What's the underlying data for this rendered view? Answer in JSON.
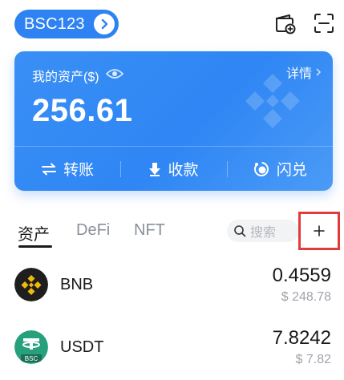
{
  "header": {
    "wallet_name": "BSC123",
    "wallet_switch_icon": "chevron-right-icon",
    "add_wallet_icon": "wallet-add-icon",
    "scan_icon": "scan-icon"
  },
  "asset_card": {
    "title": "我的资产($)",
    "visibility_icon": "eye-icon",
    "details_label": "详情",
    "total": "256.61",
    "watermark_icon": "bnb-icon",
    "actions": [
      {
        "label": "转账",
        "icon": "transfer-icon"
      },
      {
        "label": "收款",
        "icon": "receive-icon"
      },
      {
        "label": "闪兑",
        "icon": "swap-icon"
      }
    ]
  },
  "tabs": [
    {
      "label": "资产",
      "active": true
    },
    {
      "label": "DeFi",
      "active": false
    },
    {
      "label": "NFT",
      "active": false
    }
  ],
  "search": {
    "placeholder": "搜索",
    "icon": "search-icon"
  },
  "add_token_icon": "plus-icon",
  "tokens": [
    {
      "symbol": "BNB",
      "balance": "0.4559",
      "usd": "$ 248.78",
      "logo_color": "#1e1e1e",
      "logo_accent": "#f0b90b"
    },
    {
      "symbol": "USDT",
      "balance": "7.8242",
      "usd": "$ 7.82",
      "logo_color": "#26a17b",
      "badge": "BSC"
    }
  ],
  "colors": {
    "accent": "#2f82f2",
    "highlight_border": "#e23b3b"
  }
}
